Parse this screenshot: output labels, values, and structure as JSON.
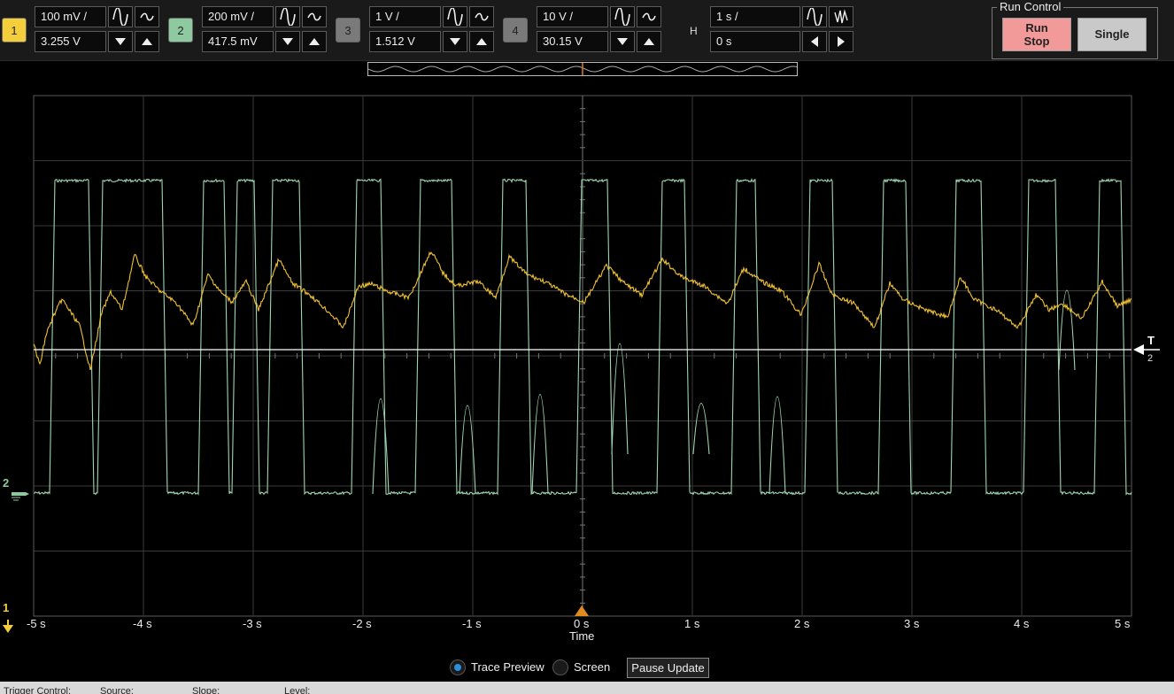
{
  "channels": [
    {
      "num": "1",
      "scale": "100 mV /",
      "offset": "3.255 V",
      "color": "#f5cf3b",
      "active": true
    },
    {
      "num": "2",
      "scale": "200 mV /",
      "offset": "417.5 mV",
      "color": "#8fc9a0",
      "active": true
    },
    {
      "num": "3",
      "scale": "1 V /",
      "offset": "1.512 V",
      "color": "#7a7a7a",
      "active": false
    },
    {
      "num": "4",
      "scale": "10 V /",
      "offset": "30.15 V",
      "color": "#7a7a7a",
      "active": false
    }
  ],
  "horizontal": {
    "label": "H",
    "scale": "1 s /",
    "position": "0 s"
  },
  "run_control": {
    "title": "Run Control",
    "run_stop": "Run\nStop",
    "single": "Single",
    "run_stop_color": "#f29a9a"
  },
  "display": {
    "x_ticks": [
      "-5 s",
      "-4 s",
      "-3 s",
      "-2 s",
      "-1 s",
      "0 s",
      "1 s",
      "2 s",
      "3 s",
      "4 s",
      "5 s"
    ],
    "x_axis_label": "Time",
    "trigger_marker": "T",
    "trigger_source": "2",
    "ch1_marker": "1",
    "ch2_marker": "2",
    "trace_colors": {
      "ch1": "#f2c230",
      "ch2": "#9fd6b0"
    }
  },
  "bottom": {
    "trace_preview": "Trace Preview",
    "screen": "Screen",
    "selected": "Trace Preview",
    "pause_update": "Pause Update"
  },
  "trigger_bar": {
    "control": "Trigger Control:",
    "source": "Source:",
    "slope": "Slope:",
    "level": "Level:"
  }
}
